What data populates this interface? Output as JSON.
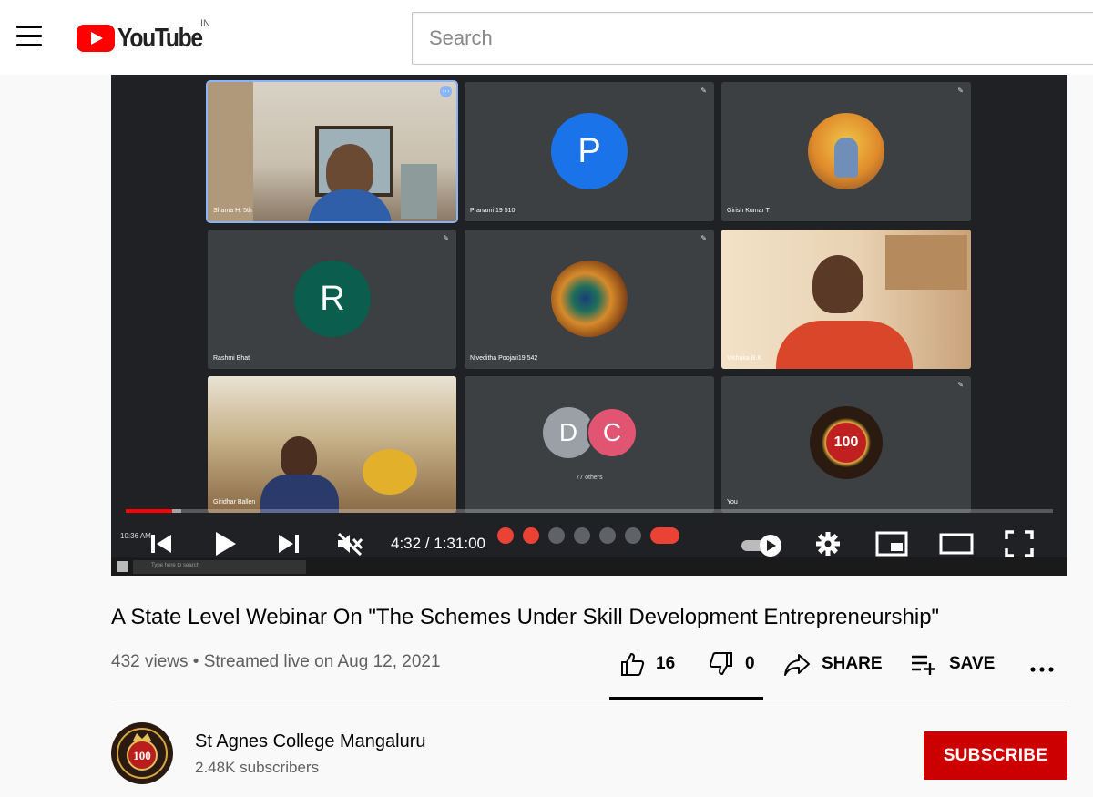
{
  "header": {
    "logo_text": "YouTube",
    "country_code": "IN",
    "search_placeholder": "Search"
  },
  "meeting": {
    "tiles": [
      {
        "name": "Shama H. 5th",
        "type": "video"
      },
      {
        "name": "Pranami 19 510",
        "type": "avatar",
        "initial": "P",
        "color": "#1a73e8"
      },
      {
        "name": "Girish Kumar T",
        "type": "image-avatar"
      },
      {
        "name": "Rashmi Bhat",
        "type": "avatar",
        "initial": "R",
        "color": "#0b5d4e"
      },
      {
        "name": "Niveditha Poojari19 542",
        "type": "image-avatar"
      },
      {
        "name": "Vishaka B.K",
        "type": "video"
      },
      {
        "name": "Giridhar Ballen",
        "type": "video"
      },
      {
        "name": "",
        "type": "group",
        "initials": [
          "D",
          "C"
        ],
        "others_label": "77 others"
      },
      {
        "name": "You",
        "type": "logo-avatar"
      }
    ],
    "taskbar_search": "Type here to search",
    "clock_overlay": "10:36 AM"
  },
  "player": {
    "current_time": "4:32",
    "duration": "1:31:00",
    "time_display": "4:32 / 1:31:00",
    "progress_played": 0.05,
    "progress_loaded": 0.06,
    "muted": true,
    "autoplay_on": true
  },
  "video": {
    "title": "A State Level Webinar On \"The Schemes Under Skill Development Entrepreneurship\"",
    "meta": "432 views • Streamed live on Aug 12, 2021",
    "likes": "16",
    "dislikes": "0",
    "share_label": "SHARE",
    "save_label": "SAVE",
    "more_label": "..."
  },
  "channel": {
    "name": "St Agnes College Mangaluru",
    "subscribers": "2.48K subscribers",
    "logo_text": "100",
    "subscribe_label": "SUBSCRIBE"
  },
  "colors": {
    "brand_red": "#ff0000",
    "subscribe_red": "#cc0000",
    "player_bg": "#202124"
  }
}
